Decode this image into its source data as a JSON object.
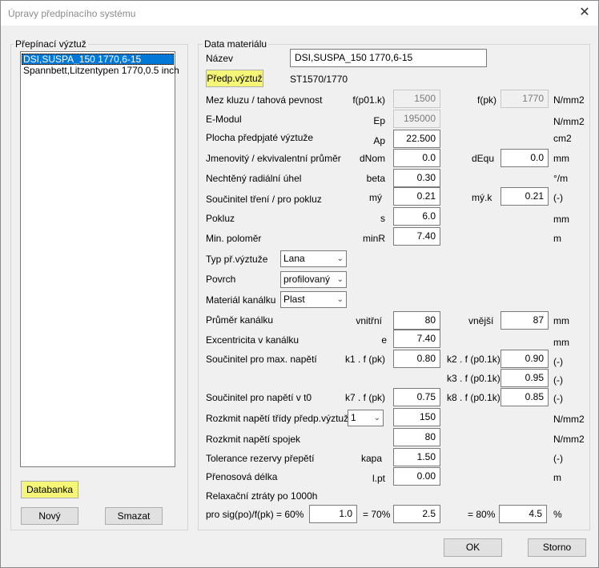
{
  "window": {
    "title": "Úpravy předpínacího systému",
    "close_glyph": "✕"
  },
  "left": {
    "group_label": "Přepínací výztuž",
    "items": [
      "DSI,SUSPA_150 1770,6-15",
      "Spannbett,Litzentypen 1770,0.5 inch"
    ],
    "databanka": "Databanka",
    "novy": "Nový",
    "smazat": "Smazat"
  },
  "right": {
    "group_label": "Data materiálu",
    "nazev_label": "Název",
    "nazev_value": "DSI,SUSPA_150 1770,6-15",
    "predp_button": "Předp.výztuž",
    "predp_value": "ST1570/1770",
    "mez": {
      "label": "Mez kluzu / tahová pevnost",
      "sym": "f(p01.k)",
      "value": "1500",
      "sym2": "f(pk)",
      "value2": "1770",
      "unit": "N/mm2"
    },
    "emodul": {
      "label": "E-Modul",
      "sym": "Ep",
      "value": "195000",
      "unit": "N/mm2"
    },
    "plocha": {
      "label": "Plocha předpjaté výztuže",
      "sym": "Ap",
      "value": "22.500",
      "unit": "cm2"
    },
    "prumer": {
      "label": "Jmenovitý / ekvivalentní průměr",
      "sym": "dNom",
      "value": "0.0",
      "sym2": "dEqu",
      "value2": "0.0",
      "unit": "mm"
    },
    "uhel": {
      "label": "Nechtěný radiální úhel",
      "sym": "beta",
      "value": "0.30",
      "unit": "°/m"
    },
    "treni": {
      "label": "Součinitel tření / pro pokluz",
      "sym": "mý",
      "value": "0.21",
      "sym2": "mý.k",
      "value2": "0.21",
      "unit": "(-)"
    },
    "pokluz": {
      "label": "Pokluz",
      "sym": "s",
      "value": "6.0",
      "unit": "mm"
    },
    "polomer": {
      "label": "Min. poloměr",
      "sym": "minR",
      "value": "7.40",
      "unit": "m"
    },
    "typ": {
      "label": "Typ př.výztuže",
      "value": "Lana"
    },
    "povrch": {
      "label": "Povrch",
      "value": "profilovaný"
    },
    "material": {
      "label": "Materiál kanálku",
      "value": "Plast"
    },
    "kanalek": {
      "label": "Průměr kanálku",
      "sym": "vnitřní",
      "value": "80",
      "sym2": "vnější",
      "value2": "87",
      "unit": "mm"
    },
    "excentricita": {
      "label": "Excentricita v kanálku",
      "sym": "e",
      "value": "7.40",
      "unit": "mm"
    },
    "maxnapeti": {
      "label": "Součinitel pro max. napětí",
      "sym": "k1 . f (pk)",
      "value": "0.80",
      "sym2": "k2 . f (p0.1k)",
      "value2": "0.90",
      "unit": "(-)",
      "sym3": "k3 . f (p0.1k)",
      "value3": "0.95",
      "unit3": "(-)"
    },
    "napetit0": {
      "label": "Součinitel pro napětí v t0",
      "sym": "k7 . f (pk)",
      "value": "0.75",
      "sym2": "k8 . f (p0.1k)",
      "value2": "0.85",
      "unit": "(-)"
    },
    "rozkmit1": {
      "label": "Rozkmit napětí třídy předp.výztuže",
      "select": "1",
      "value": "150",
      "unit": "N/mm2"
    },
    "rozkmit2": {
      "label": "Rozkmit napětí spojek",
      "value": "80",
      "unit": "N/mm2"
    },
    "tolerance": {
      "label": "Tolerance rezervy přepětí",
      "sym": "kapa",
      "value": "1.50",
      "unit": "(-)"
    },
    "prenos": {
      "label": "Přenosová délka",
      "sym": "l.pt",
      "value": "0.00",
      "unit": "m"
    },
    "relax": {
      "label": "Relaxační ztráty po 1000h",
      "pro": "pro sig(po)/f(pk) = 60%",
      "v60": "1.0",
      "l70": "= 70%",
      "v70": "2.5",
      "l80": "= 80%",
      "v80": "4.5",
      "unit": "%"
    }
  },
  "footer": {
    "ok": "OK",
    "storno": "Storno"
  },
  "colors": {
    "highlight": "#f5f578",
    "selection": "#0078d7"
  }
}
